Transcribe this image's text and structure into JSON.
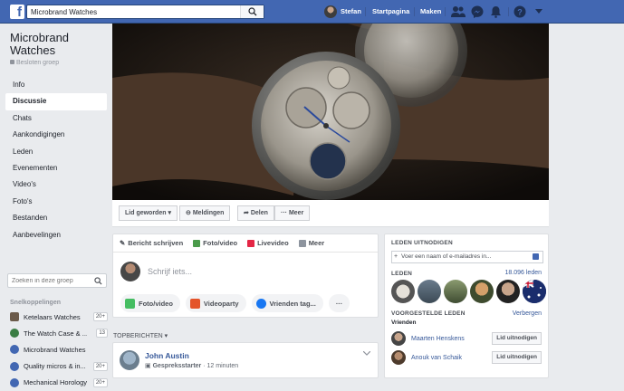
{
  "topbar": {
    "search_value": "Microbrand Watches",
    "user_name": "Stefan",
    "nav_home": "Startpagina",
    "nav_create": "Maken"
  },
  "group": {
    "title": "Microbrand Watches",
    "privacy": "Besloten groep"
  },
  "sidebar": {
    "items": [
      {
        "label": "Info"
      },
      {
        "label": "Discussie",
        "active": true
      },
      {
        "label": "Chats"
      },
      {
        "label": "Aankondigingen"
      },
      {
        "label": "Leden"
      },
      {
        "label": "Evenementen"
      },
      {
        "label": "Video's"
      },
      {
        "label": "Foto's"
      },
      {
        "label": "Bestanden"
      },
      {
        "label": "Aanbevelingen"
      }
    ],
    "group_search_placeholder": "Zoeken in deze groep",
    "shortcuts_heading": "Snelkoppelingen",
    "shortcuts": [
      {
        "label": "Ketelaars Watches",
        "badge": "20+",
        "color": "#6b5a4a"
      },
      {
        "label": "The Watch Case & ...",
        "badge": "13",
        "color": "#3a7d44"
      },
      {
        "label": "Microbrand Watches",
        "badge": "",
        "color": "#4267b2"
      },
      {
        "label": "Quality micros & in...",
        "badge": "20+",
        "color": "#4267b2"
      },
      {
        "label": "Mechanical Horology",
        "badge": "20+",
        "color": "#4267b2"
      }
    ]
  },
  "actions": {
    "member": "Lid geworden",
    "notifications": "Meldingen",
    "share": "Delen",
    "more": "Meer"
  },
  "composer": {
    "tabs": [
      "Bericht schrijven",
      "Foto/video",
      "Livevideo",
      "Meer"
    ],
    "placeholder": "Schrijf iets...",
    "pills": [
      "Foto/video",
      "Videoparty",
      "Vrienden tag..."
    ]
  },
  "feed": {
    "heading": "TOPBERICHTEN",
    "post": {
      "author": "John Austin",
      "role": "Gespreksstarter",
      "time": "12 minuten"
    }
  },
  "right": {
    "invite_heading": "LEDEN UITNODIGEN",
    "invite_placeholder": "Voer een naam of e-mailadres in...",
    "members_heading": "LEDEN",
    "members_count": "18.096 leden",
    "suggested_heading": "VOORGESTELDE LEDEN",
    "refresh": "Verbergen",
    "friends_label": "Vrienden",
    "suggested": [
      {
        "name": "Maarten Henskens",
        "button": "Lid uitnodigen"
      },
      {
        "name": "Anouk van Schaik",
        "button": "Lid uitnodigen"
      }
    ]
  },
  "colors": {
    "brand": "#4267b2",
    "link": "#365899",
    "background": "#e9ebee"
  }
}
